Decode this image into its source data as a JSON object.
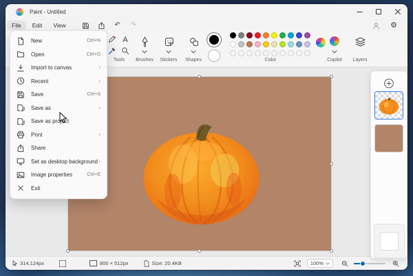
{
  "window": {
    "title": "Paint - Untitled"
  },
  "menubar": {
    "items": [
      "File",
      "Edit",
      "View"
    ]
  },
  "file_menu": {
    "items": [
      {
        "icon": "new",
        "label": "New",
        "right": "Ctrl+N"
      },
      {
        "icon": "open",
        "label": "Open",
        "right": "Ctrl+O"
      },
      {
        "icon": "import",
        "label": "Import to canvas",
        "right": "›"
      },
      {
        "icon": "recent",
        "label": "Recent",
        "right": "›"
      },
      {
        "icon": "save",
        "label": "Save",
        "right": "Ctrl+S"
      },
      {
        "icon": "save_as",
        "label": "Save as",
        "right": "›"
      },
      {
        "icon": "save_as",
        "label": "Save as project",
        "right": ""
      },
      {
        "icon": "print",
        "label": "Print",
        "right": "›"
      },
      {
        "icon": "share",
        "label": "Share",
        "right": ""
      },
      {
        "icon": "desktop",
        "label": "Set as desktop background",
        "right": "›"
      },
      {
        "icon": "imgprops",
        "label": "Image properties",
        "right": "Ctrl+E"
      },
      {
        "icon": "exit",
        "label": "Exit",
        "right": ""
      }
    ]
  },
  "toolbar": {
    "tools_label": "Tools",
    "brushes_label": "Brushes",
    "stickers_label": "Stickers",
    "shapes_label": "Shapes",
    "color_label": "Color",
    "copilot_label": "Copilot",
    "layers_label": "Layers",
    "palette": {
      "primary": "#000000",
      "secondary": "#ffffff",
      "row1": [
        "#000000",
        "#7f7f7f",
        "#88001b",
        "#ec1c24",
        "#ff7f27",
        "#fef200",
        "#22b14c",
        "#00a2e8",
        "#3f48cc",
        "#a349a4"
      ],
      "row2": [
        "#ffffff",
        "#c3c3c3",
        "#b97a56",
        "#ffaec9",
        "#ffc90e",
        "#efe4b0",
        "#b5e61d",
        "#99d9ea",
        "#7092be",
        "#c8bfe7"
      ],
      "empty_slots": 10
    }
  },
  "canvas": {
    "background_color": "#b28468"
  },
  "statusbar": {
    "cursor_position": "314,124px",
    "canvas_size": "800 × 512px",
    "file_size": "Size: 20.4KB",
    "zoom": "100%"
  }
}
